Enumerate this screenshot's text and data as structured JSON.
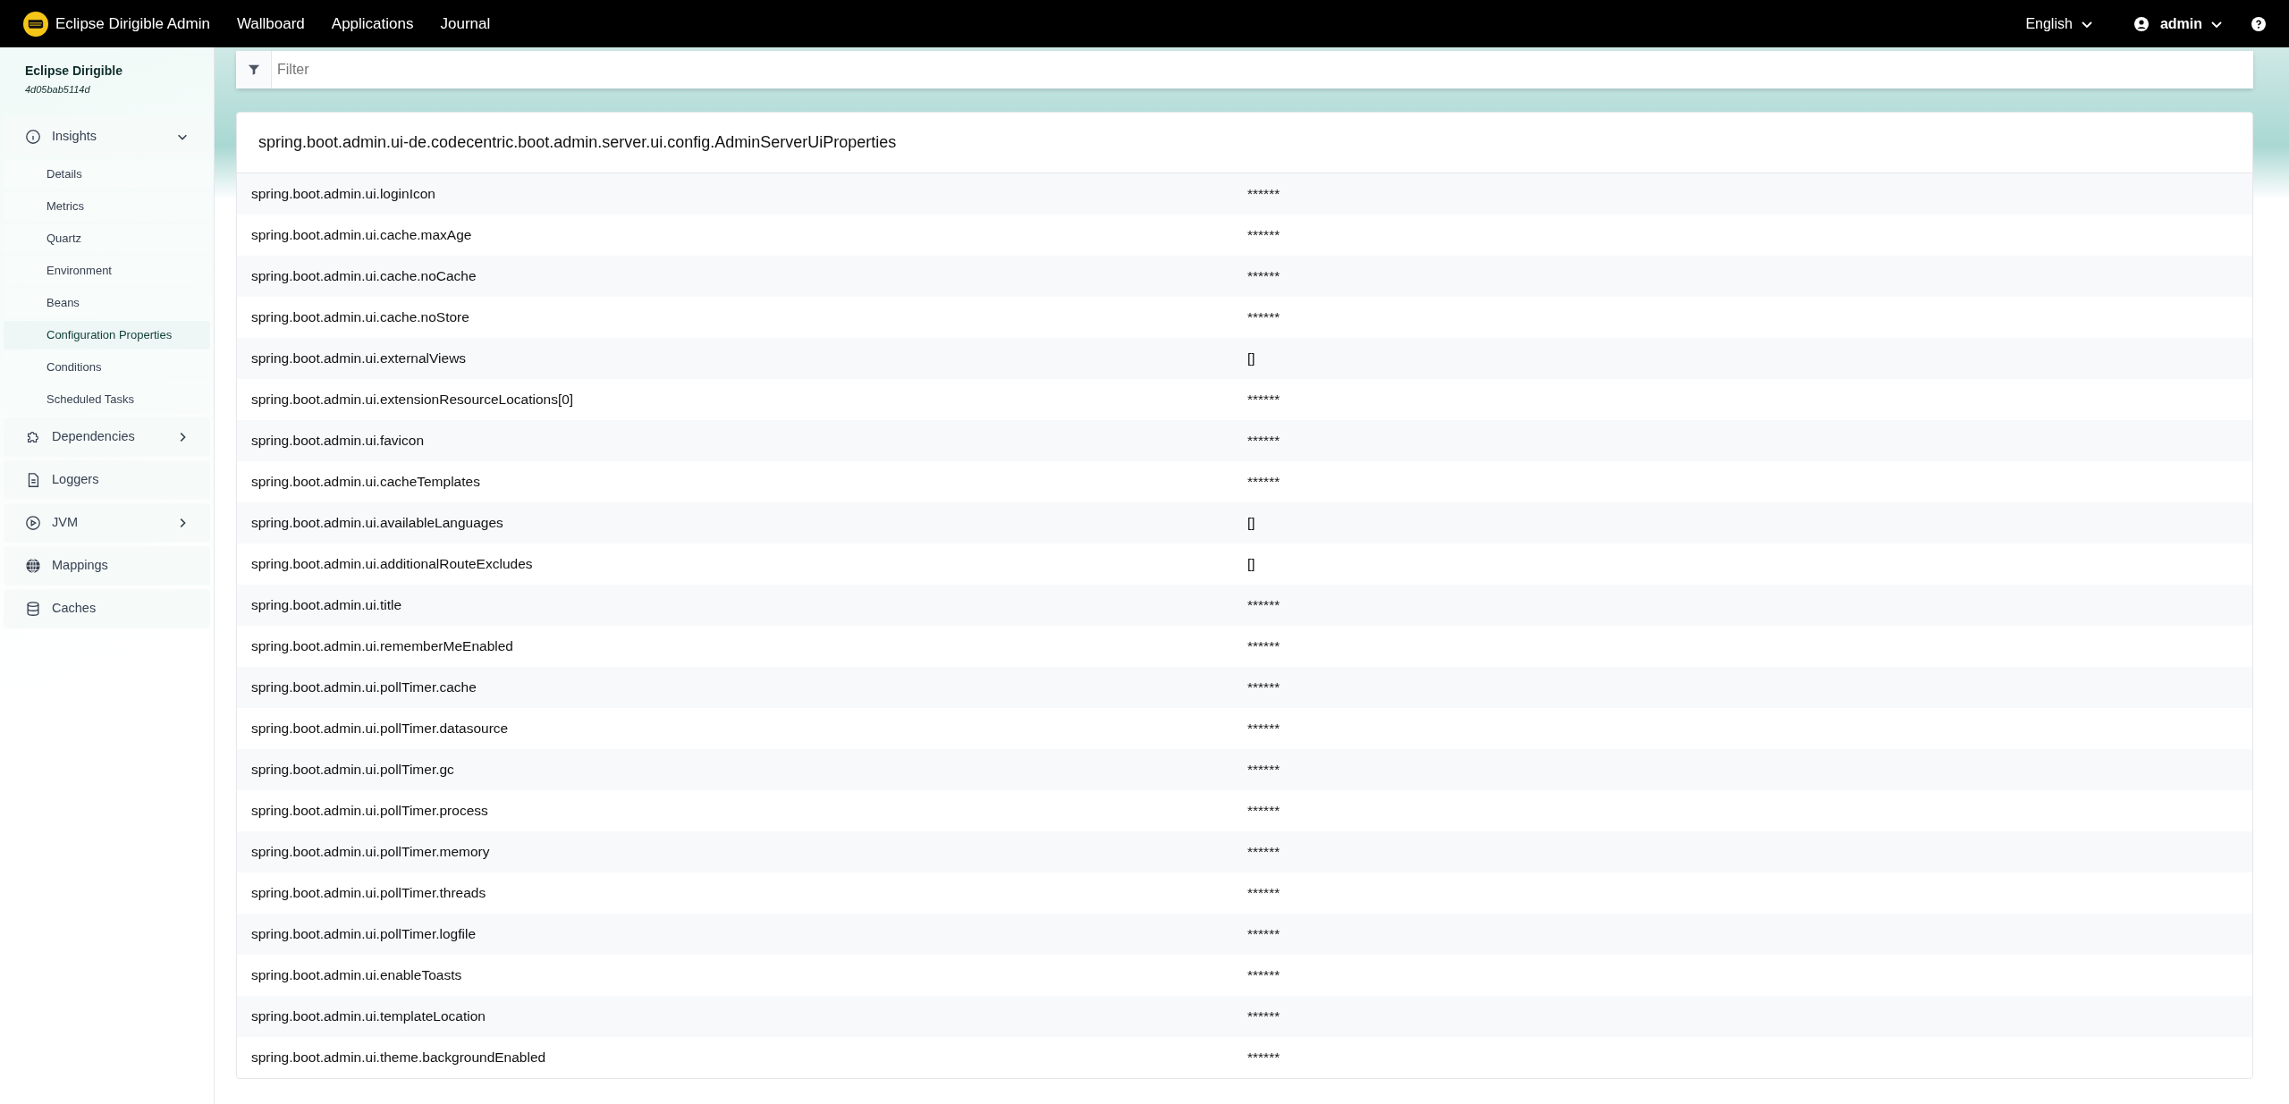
{
  "navbar": {
    "brand": "Eclipse Dirigible Admin",
    "links": [
      "Wallboard",
      "Applications",
      "Journal"
    ],
    "language": "English",
    "user": "admin"
  },
  "sidebar": {
    "app_name": "Eclipse Dirigible",
    "instance_id": "4d05bab5114d",
    "items": [
      {
        "label": "Insights",
        "expanded": true,
        "children": [
          {
            "label": "Details",
            "selected": false
          },
          {
            "label": "Metrics",
            "selected": false
          },
          {
            "label": "Quartz",
            "selected": false
          },
          {
            "label": "Environment",
            "selected": false
          },
          {
            "label": "Beans",
            "selected": false
          },
          {
            "label": "Configuration Properties",
            "selected": true
          },
          {
            "label": "Conditions",
            "selected": false
          },
          {
            "label": "Scheduled Tasks",
            "selected": false
          }
        ]
      },
      {
        "label": "Dependencies",
        "expanded": false
      },
      {
        "label": "Loggers"
      },
      {
        "label": "JVM",
        "expanded": false
      },
      {
        "label": "Mappings"
      },
      {
        "label": "Caches"
      }
    ]
  },
  "filter": {
    "placeholder": "Filter"
  },
  "properties_card": {
    "title": "spring.boot.admin.ui-de.codecentric.boot.admin.server.ui.config.AdminServerUiProperties",
    "rows": [
      {
        "name": "spring.boot.admin.ui.loginIcon",
        "value": "******"
      },
      {
        "name": "spring.boot.admin.ui.cache.maxAge",
        "value": "******"
      },
      {
        "name": "spring.boot.admin.ui.cache.noCache",
        "value": "******"
      },
      {
        "name": "spring.boot.admin.ui.cache.noStore",
        "value": "******"
      },
      {
        "name": "spring.boot.admin.ui.externalViews",
        "value": "[]"
      },
      {
        "name": "spring.boot.admin.ui.extensionResourceLocations[0]",
        "value": "******"
      },
      {
        "name": "spring.boot.admin.ui.favicon",
        "value": "******"
      },
      {
        "name": "spring.boot.admin.ui.cacheTemplates",
        "value": "******"
      },
      {
        "name": "spring.boot.admin.ui.availableLanguages",
        "value": "[]"
      },
      {
        "name": "spring.boot.admin.ui.additionalRouteExcludes",
        "value": "[]"
      },
      {
        "name": "spring.boot.admin.ui.title",
        "value": "******"
      },
      {
        "name": "spring.boot.admin.ui.rememberMeEnabled",
        "value": "******"
      },
      {
        "name": "spring.boot.admin.ui.pollTimer.cache",
        "value": "******"
      },
      {
        "name": "spring.boot.admin.ui.pollTimer.datasource",
        "value": "******"
      },
      {
        "name": "spring.boot.admin.ui.pollTimer.gc",
        "value": "******"
      },
      {
        "name": "spring.boot.admin.ui.pollTimer.process",
        "value": "******"
      },
      {
        "name": "spring.boot.admin.ui.pollTimer.memory",
        "value": "******"
      },
      {
        "name": "spring.boot.admin.ui.pollTimer.threads",
        "value": "******"
      },
      {
        "name": "spring.boot.admin.ui.pollTimer.logfile",
        "value": "******"
      },
      {
        "name": "spring.boot.admin.ui.enableToasts",
        "value": "******"
      },
      {
        "name": "spring.boot.admin.ui.templateLocation",
        "value": "******"
      },
      {
        "name": "spring.boot.admin.ui.theme.backgroundEnabled",
        "value": "******"
      }
    ]
  }
}
